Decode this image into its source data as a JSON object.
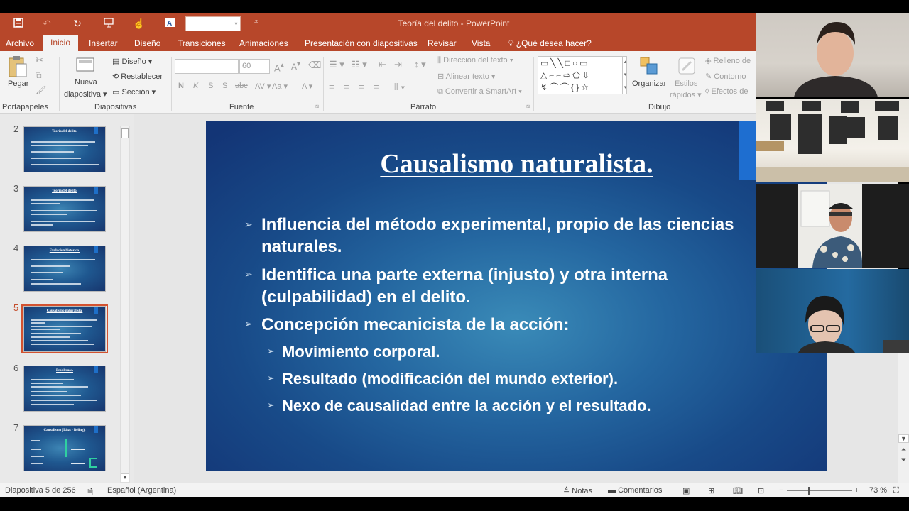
{
  "window": {
    "title": "Teoría del delito - PowerPoint"
  },
  "quick_access": {
    "save_icon": "save-icon",
    "undo_icon": "undo-icon",
    "redo_icon": "redo-icon",
    "presenter_icon": "present-icon",
    "touch_icon": "touch-mode-icon",
    "font_color_icon": "font-color-icon",
    "customize_icon": "customize-qat-icon"
  },
  "tabs": [
    "Archivo",
    "Inicio",
    "Insertar",
    "Diseño",
    "Transiciones",
    "Animaciones",
    "Presentación con diapositivas",
    "Revisar",
    "Vista"
  ],
  "tell_me": "¿Qué desea hacer?",
  "ribbon": {
    "clipboard": {
      "paste": "Pegar",
      "group": "Portapapeles"
    },
    "slides": {
      "new_slide_line1": "Nueva",
      "new_slide_line2": "diapositiva",
      "layout": "Diseño",
      "reset": "Restablecer",
      "section": "Sección",
      "group": "Diapositivas"
    },
    "font": {
      "size": "60",
      "group": "Fuente",
      "bold": "N",
      "italic": "K",
      "underline": "S",
      "shadow": "S",
      "strike": "abc",
      "spacing": "AV",
      "case": "Aa",
      "color": "A",
      "grow": "A",
      "shrink": "A"
    },
    "paragraph": {
      "text_direction": "Dirección del texto",
      "align_text": "Alinear texto",
      "smartart": "Convertir a SmartArt",
      "group": "Párrafo"
    },
    "drawing": {
      "arrange": "Organizar",
      "styles_line1": "Estilos",
      "styles_line2": "rápidos",
      "fill": "Relleno de",
      "outline": "Contorno",
      "effects": "Efectos de",
      "group": "Dibujo"
    }
  },
  "thumbnails": [
    {
      "num": "2",
      "title": "Teoría del delito."
    },
    {
      "num": "3",
      "title": "Teoría del delito."
    },
    {
      "num": "4",
      "title": "Evolución histórica."
    },
    {
      "num": "5",
      "title": "Causalismo naturalista."
    },
    {
      "num": "6",
      "title": "Problemas."
    },
    {
      "num": "7",
      "title": "Causalismo (Liszt - Beling)."
    }
  ],
  "slide": {
    "title": "Causalismo naturalista.",
    "bullets": [
      {
        "line1": "Influencia del método experimental, propio de las ciencias",
        "line2": "naturales."
      },
      {
        "line1": "Identifica una parte externa (injusto) y otra interna",
        "line2": "(culpabilidad) en el delito."
      },
      {
        "line1": "Concepción mecanicista de la acción:"
      }
    ],
    "sub_bullets": [
      "Movimiento corporal.",
      "Resultado (modificación del mundo exterior).",
      "Nexo de causalidad entre la acción y el resultado."
    ]
  },
  "statusbar": {
    "slide_info": "Diapositiva 5 de 256",
    "language": "Español (Argentina)",
    "notes": "Notas",
    "comments": "Comentarios",
    "zoom": "73 %"
  }
}
